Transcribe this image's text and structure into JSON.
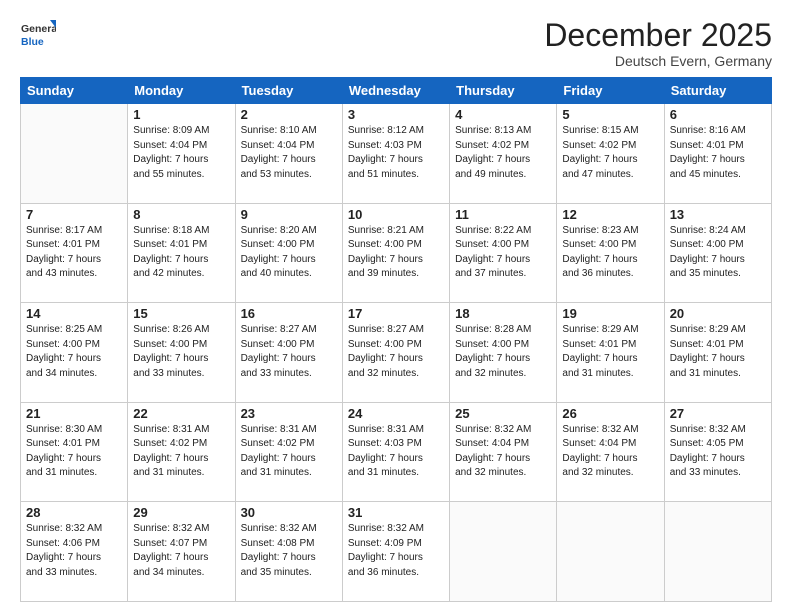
{
  "logo": {
    "general": "General",
    "blue": "Blue"
  },
  "header": {
    "month": "December 2025",
    "location": "Deutsch Evern, Germany"
  },
  "days_of_week": [
    "Sunday",
    "Monday",
    "Tuesday",
    "Wednesday",
    "Thursday",
    "Friday",
    "Saturday"
  ],
  "weeks": [
    [
      {
        "day": "",
        "info": ""
      },
      {
        "day": "1",
        "info": "Sunrise: 8:09 AM\nSunset: 4:04 PM\nDaylight: 7 hours\nand 55 minutes."
      },
      {
        "day": "2",
        "info": "Sunrise: 8:10 AM\nSunset: 4:04 PM\nDaylight: 7 hours\nand 53 minutes."
      },
      {
        "day": "3",
        "info": "Sunrise: 8:12 AM\nSunset: 4:03 PM\nDaylight: 7 hours\nand 51 minutes."
      },
      {
        "day": "4",
        "info": "Sunrise: 8:13 AM\nSunset: 4:02 PM\nDaylight: 7 hours\nand 49 minutes."
      },
      {
        "day": "5",
        "info": "Sunrise: 8:15 AM\nSunset: 4:02 PM\nDaylight: 7 hours\nand 47 minutes."
      },
      {
        "day": "6",
        "info": "Sunrise: 8:16 AM\nSunset: 4:01 PM\nDaylight: 7 hours\nand 45 minutes."
      }
    ],
    [
      {
        "day": "7",
        "info": "Sunrise: 8:17 AM\nSunset: 4:01 PM\nDaylight: 7 hours\nand 43 minutes."
      },
      {
        "day": "8",
        "info": "Sunrise: 8:18 AM\nSunset: 4:01 PM\nDaylight: 7 hours\nand 42 minutes."
      },
      {
        "day": "9",
        "info": "Sunrise: 8:20 AM\nSunset: 4:00 PM\nDaylight: 7 hours\nand 40 minutes."
      },
      {
        "day": "10",
        "info": "Sunrise: 8:21 AM\nSunset: 4:00 PM\nDaylight: 7 hours\nand 39 minutes."
      },
      {
        "day": "11",
        "info": "Sunrise: 8:22 AM\nSunset: 4:00 PM\nDaylight: 7 hours\nand 37 minutes."
      },
      {
        "day": "12",
        "info": "Sunrise: 8:23 AM\nSunset: 4:00 PM\nDaylight: 7 hours\nand 36 minutes."
      },
      {
        "day": "13",
        "info": "Sunrise: 8:24 AM\nSunset: 4:00 PM\nDaylight: 7 hours\nand 35 minutes."
      }
    ],
    [
      {
        "day": "14",
        "info": "Sunrise: 8:25 AM\nSunset: 4:00 PM\nDaylight: 7 hours\nand 34 minutes."
      },
      {
        "day": "15",
        "info": "Sunrise: 8:26 AM\nSunset: 4:00 PM\nDaylight: 7 hours\nand 33 minutes."
      },
      {
        "day": "16",
        "info": "Sunrise: 8:27 AM\nSunset: 4:00 PM\nDaylight: 7 hours\nand 33 minutes."
      },
      {
        "day": "17",
        "info": "Sunrise: 8:27 AM\nSunset: 4:00 PM\nDaylight: 7 hours\nand 32 minutes."
      },
      {
        "day": "18",
        "info": "Sunrise: 8:28 AM\nSunset: 4:00 PM\nDaylight: 7 hours\nand 32 minutes."
      },
      {
        "day": "19",
        "info": "Sunrise: 8:29 AM\nSunset: 4:01 PM\nDaylight: 7 hours\nand 31 minutes."
      },
      {
        "day": "20",
        "info": "Sunrise: 8:29 AM\nSunset: 4:01 PM\nDaylight: 7 hours\nand 31 minutes."
      }
    ],
    [
      {
        "day": "21",
        "info": "Sunrise: 8:30 AM\nSunset: 4:01 PM\nDaylight: 7 hours\nand 31 minutes."
      },
      {
        "day": "22",
        "info": "Sunrise: 8:31 AM\nSunset: 4:02 PM\nDaylight: 7 hours\nand 31 minutes."
      },
      {
        "day": "23",
        "info": "Sunrise: 8:31 AM\nSunset: 4:02 PM\nDaylight: 7 hours\nand 31 minutes."
      },
      {
        "day": "24",
        "info": "Sunrise: 8:31 AM\nSunset: 4:03 PM\nDaylight: 7 hours\nand 31 minutes."
      },
      {
        "day": "25",
        "info": "Sunrise: 8:32 AM\nSunset: 4:04 PM\nDaylight: 7 hours\nand 32 minutes."
      },
      {
        "day": "26",
        "info": "Sunrise: 8:32 AM\nSunset: 4:04 PM\nDaylight: 7 hours\nand 32 minutes."
      },
      {
        "day": "27",
        "info": "Sunrise: 8:32 AM\nSunset: 4:05 PM\nDaylight: 7 hours\nand 33 minutes."
      }
    ],
    [
      {
        "day": "28",
        "info": "Sunrise: 8:32 AM\nSunset: 4:06 PM\nDaylight: 7 hours\nand 33 minutes."
      },
      {
        "day": "29",
        "info": "Sunrise: 8:32 AM\nSunset: 4:07 PM\nDaylight: 7 hours\nand 34 minutes."
      },
      {
        "day": "30",
        "info": "Sunrise: 8:32 AM\nSunset: 4:08 PM\nDaylight: 7 hours\nand 35 minutes."
      },
      {
        "day": "31",
        "info": "Sunrise: 8:32 AM\nSunset: 4:09 PM\nDaylight: 7 hours\nand 36 minutes."
      },
      {
        "day": "",
        "info": ""
      },
      {
        "day": "",
        "info": ""
      },
      {
        "day": "",
        "info": ""
      }
    ]
  ]
}
